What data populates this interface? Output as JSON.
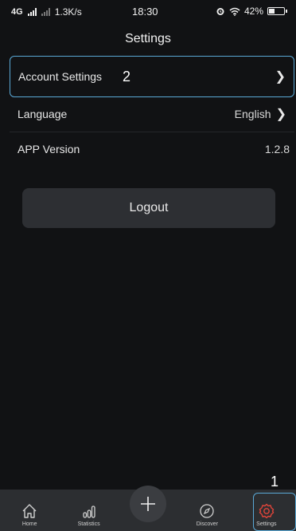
{
  "status_bar": {
    "network": "4G",
    "speed": "1.3K/s",
    "time": "18:30",
    "battery": "42%",
    "battery_level": 0.42
  },
  "header": {
    "title": "Settings"
  },
  "settings_list": {
    "account": {
      "label": "Account Settings"
    },
    "language": {
      "label": "Language",
      "value": "English"
    },
    "version": {
      "label": "APP Version",
      "value": "1.2.8"
    }
  },
  "logout": {
    "label": "Logout"
  },
  "callouts": {
    "one": "1",
    "two": "2"
  },
  "tabbar": {
    "home": "Home",
    "statistics": "Statistics",
    "discover": "Discover",
    "settings": "Settings"
  },
  "colors": {
    "background": "#111214",
    "highlight": "#5aa9d6",
    "active_tab": "#e0453a"
  },
  "icons": {
    "home": "home-icon",
    "statistics": "statistics-icon",
    "add": "add-icon",
    "discover": "compass-icon",
    "settings": "gear-icon"
  }
}
